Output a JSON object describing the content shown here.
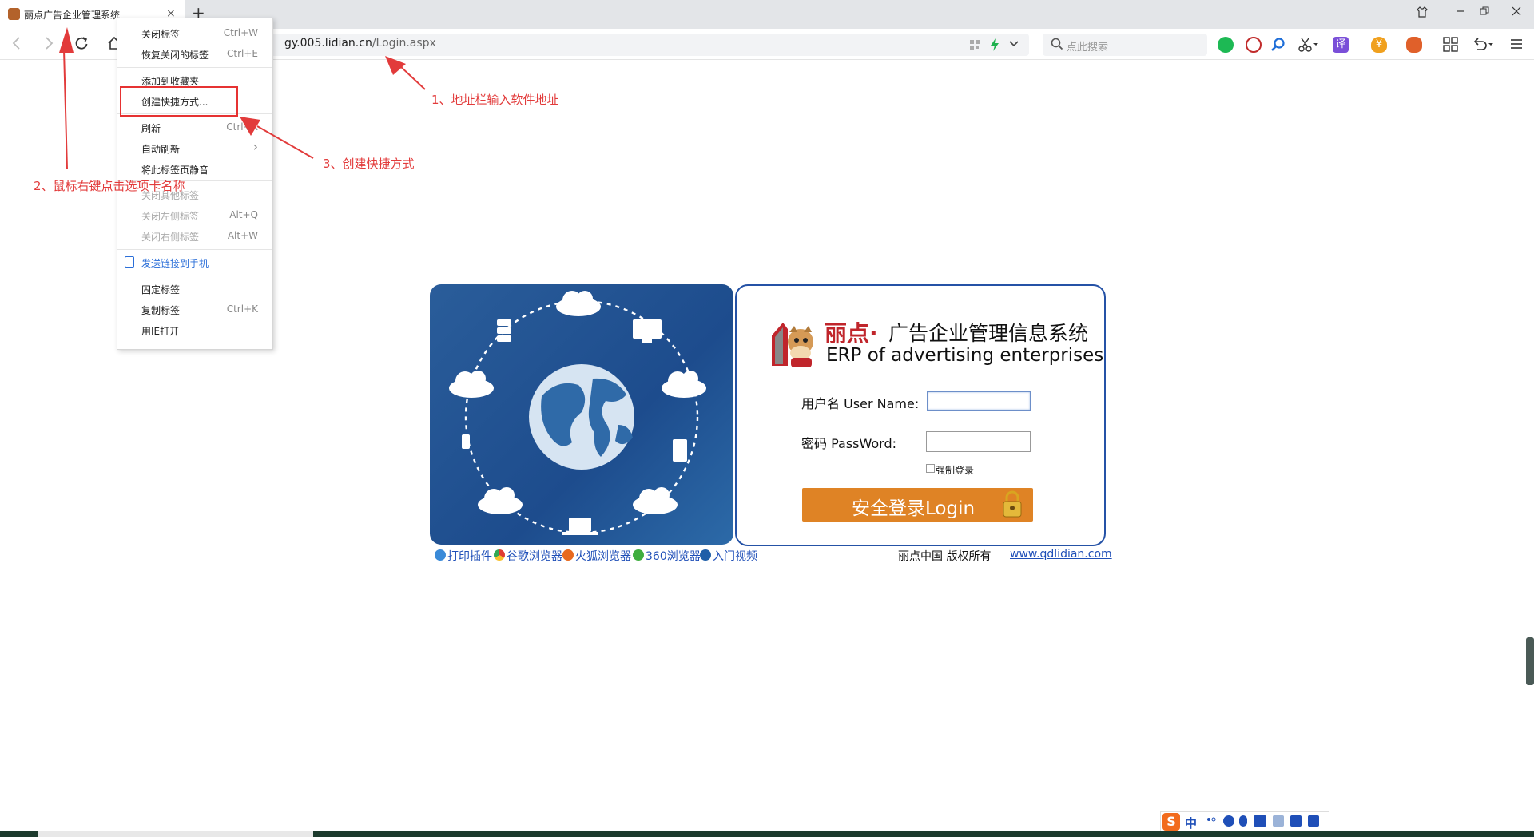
{
  "tab": {
    "title": "丽点广告企业管理系统",
    "close": "×"
  },
  "newtab": "+",
  "toolbar": {
    "url_host": "gy.005.lidian.cn",
    "url_path": "/Login.aspx",
    "search_placeholder": "点此搜索"
  },
  "context_menu": {
    "items": [
      {
        "label": "关闭标签",
        "shortcut": "Ctrl+W"
      },
      {
        "label": "恢复关闭的标签",
        "shortcut": "Ctrl+E"
      },
      {
        "label": "添加到收藏夹",
        "shortcut": ""
      },
      {
        "label": "创建快捷方式...",
        "shortcut": ""
      },
      {
        "label": "刷新",
        "shortcut": "Ctrl+R"
      },
      {
        "label": "自动刷新",
        "shortcut": "›"
      },
      {
        "label": "将此标签页静音",
        "shortcut": ""
      },
      {
        "label": "关闭其他标签",
        "shortcut": ""
      },
      {
        "label": "关闭左侧标签",
        "shortcut": "Alt+Q"
      },
      {
        "label": "关闭右侧标签",
        "shortcut": "Alt+W"
      },
      {
        "label": "发送链接到手机",
        "shortcut": ""
      },
      {
        "label": "固定标签",
        "shortcut": ""
      },
      {
        "label": "复制标签",
        "shortcut": "Ctrl+K"
      },
      {
        "label": "用IE打开",
        "shortcut": ""
      }
    ]
  },
  "annotations": {
    "step1": "1、地址栏输入软件地址",
    "step2": "2、鼠标右键点击选项卡名称",
    "step3": "3、创建快捷方式"
  },
  "login": {
    "brand_red": "丽点·",
    "brand_title": "广告企业管理信息系统",
    "brand_en": "ERP of advertising enterprises",
    "user_label": "用户名 User Name:",
    "pwd_label": "密码 PassWord:",
    "force_label": "强制登录",
    "login_button": "安全登录Login"
  },
  "footer": {
    "links": [
      "打印插件",
      "谷歌浏览器",
      "火狐浏览器",
      "360浏览器",
      "入门视频"
    ],
    "copyright": "丽点中国 版权所有",
    "site": "www.qdlidian.com"
  },
  "ime": {
    "lang": "中"
  },
  "colors": {
    "accent_red": "#e23b3b",
    "login_orange": "#df8325",
    "panel_blue": "#2552a6",
    "link_blue": "#1f4fb8"
  }
}
